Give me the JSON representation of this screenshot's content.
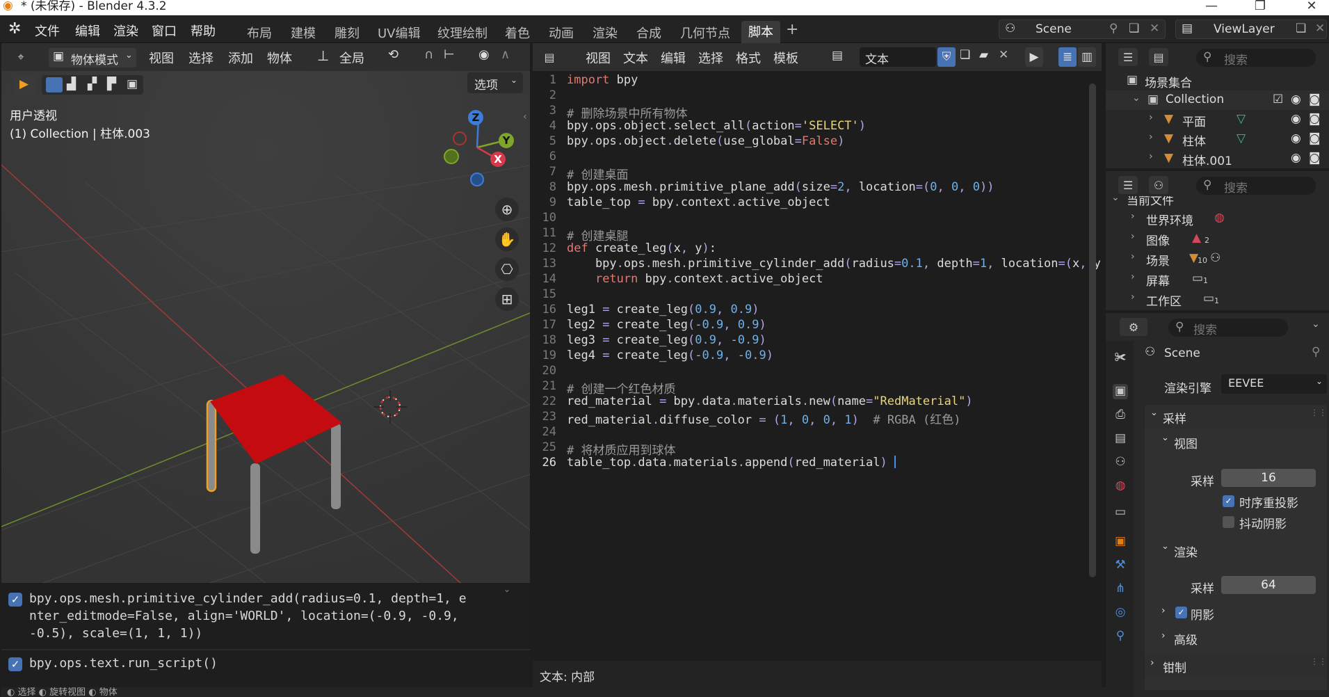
{
  "window": {
    "title": "* (未保存) - Blender 4.3.2"
  },
  "menu": [
    "文件",
    "编辑",
    "渲染",
    "窗口",
    "帮助"
  ],
  "workspaces": [
    "布局",
    "建模",
    "雕刻",
    "UV编辑",
    "纹理绘制",
    "着色",
    "动画",
    "渲染",
    "合成",
    "几何节点",
    "脚本"
  ],
  "active_workspace": "脚本",
  "scene_field": "Scene",
  "viewlayer_field": "ViewLayer",
  "viewport": {
    "mode": "物体模式",
    "menus": [
      "视图",
      "选择",
      "添加",
      "物体"
    ],
    "transform": "全局",
    "options": "选项",
    "overlay_title": "用户透视",
    "overlay_sub": "(1) Collection | 柱体.003",
    "gizmo": {
      "z": "Z",
      "y": "Y",
      "x": "X"
    },
    "table_color": "#c40c10"
  },
  "console": {
    "line1": "bpy.ops.mesh.primitive_cylinder_add(radius=0.1, depth=1, e",
    "line2": "nter_editmode=False, align='WORLD', location=(-0.9, -0.9,",
    "line3": "-0.5), scale=(1, 1, 1))",
    "line4": "bpy.ops.text.run_script()",
    "footer": "◐ 选择   ◐ 旋转视图   ◐ 物体"
  },
  "text_editor": {
    "menus": [
      "视图",
      "文本",
      "编辑",
      "选择",
      "格式",
      "模板"
    ],
    "text_name": "文本",
    "status": "文本: 内部",
    "code": [
      "import bpy",
      "",
      "# 删除场景中所有物体",
      "bpy.ops.object.select_all(action='SELECT')",
      "bpy.ops.object.delete(use_global=False)",
      "",
      "# 创建桌面",
      "bpy.ops.mesh.primitive_plane_add(size=2, location=(0, 0, 0))",
      "table_top = bpy.context.active_object",
      "",
      "# 创建桌腿",
      "def create_leg(x, y):",
      "    bpy.ops.mesh.primitive_cylinder_add(radius=0.1, depth=1, location=(x, y",
      "    return bpy.context.active_object",
      "",
      "leg1 = create_leg(0.9, 0.9)",
      "leg2 = create_leg(-0.9, 0.9)",
      "leg3 = create_leg(0.9, -0.9)",
      "leg4 = create_leg(-0.9, -0.9)",
      "",
      "# 创建一个红色材质",
      "red_material = bpy.data.materials.new(name=\"RedMaterial\")",
      "red_material.diffuse_color = (1, 0, 0, 1)  # RGBA (红色)",
      "",
      "# 将材质应用到球体",
      "table_top.data.materials.append(red_material) "
    ],
    "current_line": 26
  },
  "outliner": {
    "search": "搜索",
    "root": "场景集合",
    "collection": "Collection",
    "items": [
      "平面",
      "柱体",
      "柱体.001"
    ]
  },
  "blend_file": {
    "search": "搜索",
    "header": "当前文件",
    "items": [
      "世界环境",
      "图像",
      "场景",
      "屏幕",
      "工作区"
    ],
    "counts": [
      "",
      "2",
      "10",
      "1",
      "1"
    ]
  },
  "properties": {
    "search": "搜索",
    "scene": "Scene",
    "engine_label": "渲染引擎",
    "engine": "EEVEE",
    "sampling": "采样",
    "viewport_sec": "视图",
    "samples_label": "采样",
    "viewport_samples": "16",
    "temporal": "时序重投影",
    "jitter": "抖动阴影",
    "render_sec": "渲染",
    "render_samples": "64",
    "shadows": "阴影",
    "advanced": "高级",
    "clamping": "钳制"
  }
}
